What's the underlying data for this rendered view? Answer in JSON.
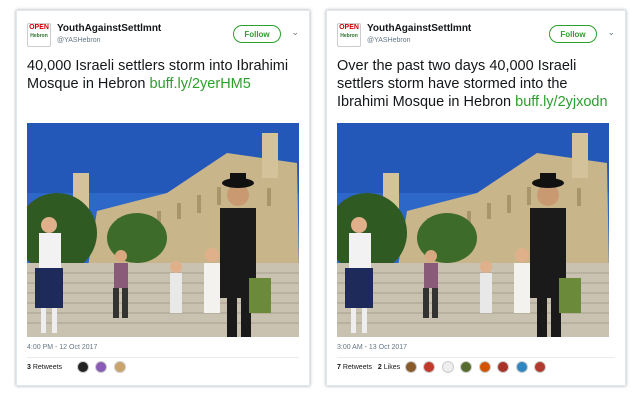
{
  "tweets": [
    {
      "account_name": "YouthAgainstSettlmnt",
      "handle": "@YASHebron",
      "avatar_text": "OPEN",
      "avatar_subtext": "Hebron",
      "follow_label": "Follow",
      "text": "40,000 Israeli settlers storm into Ibrahimi Mosque in Hebron",
      "link": "buff.ly/2yerHM5",
      "timestamp": "4:00 PM - 12 Oct 2017",
      "retweets_count": "3",
      "retweets_label": "Retweets",
      "likes_count": "",
      "likes_label": "",
      "face_colors": [
        "#222222",
        "#8a5bb5",
        "#c9a36b"
      ]
    },
    {
      "account_name": "YouthAgainstSettlmnt",
      "handle": "@YASHebron",
      "avatar_text": "OPEN",
      "avatar_subtext": "Hebron",
      "follow_label": "Follow",
      "text": "Over the past two days 40,000 Israeli settlers storm have stormed into the Ibrahimi Mosque in Hebron",
      "link": "buff.ly/2yjxodn",
      "timestamp": "3:00 AM - 13 Oct 2017",
      "retweets_count": "7",
      "retweets_label": "Retweets",
      "likes_count": "2",
      "likes_label": "Likes",
      "face_colors": [
        "#8b5a2b",
        "#c0392b",
        "#eeeeee",
        "#556b2f",
        "#d35400",
        "#a93226",
        "#2e86c1",
        "#b03a2e"
      ]
    }
  ]
}
